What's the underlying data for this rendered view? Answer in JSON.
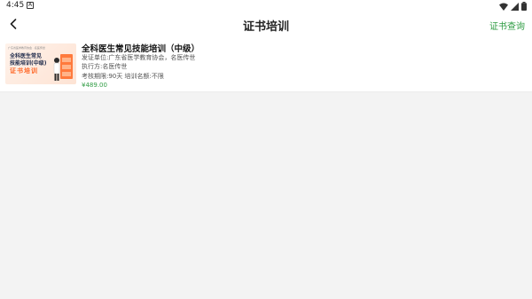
{
  "status_bar": {
    "time": "4:45",
    "notification_glyph": "A",
    "icons": [
      "wifi-icon",
      "signal-icon",
      "battery-icon"
    ]
  },
  "header": {
    "back_icon": "chevron-left-icon",
    "title": "证书培训",
    "action_label": "证书查询"
  },
  "courses": [
    {
      "thumbnail": {
        "org_text": "广东省医学教育协会 · 名医传世",
        "line1": "全科医生常见",
        "line2": "技能培训(中级)",
        "line3": "证书培训"
      },
      "title": "全科医生常见技能培训（中级）",
      "issuer": "发证单位:广东省医学教育协会，名医传世",
      "executor": "执行方:名医传世",
      "period": "考核期限:90天 培训名额:不限",
      "price": "¥489.00"
    }
  ],
  "colors": {
    "accent_green": "#2f9c43",
    "thumb_orange": "#ff6a2b",
    "background": "#f3f3f3"
  }
}
